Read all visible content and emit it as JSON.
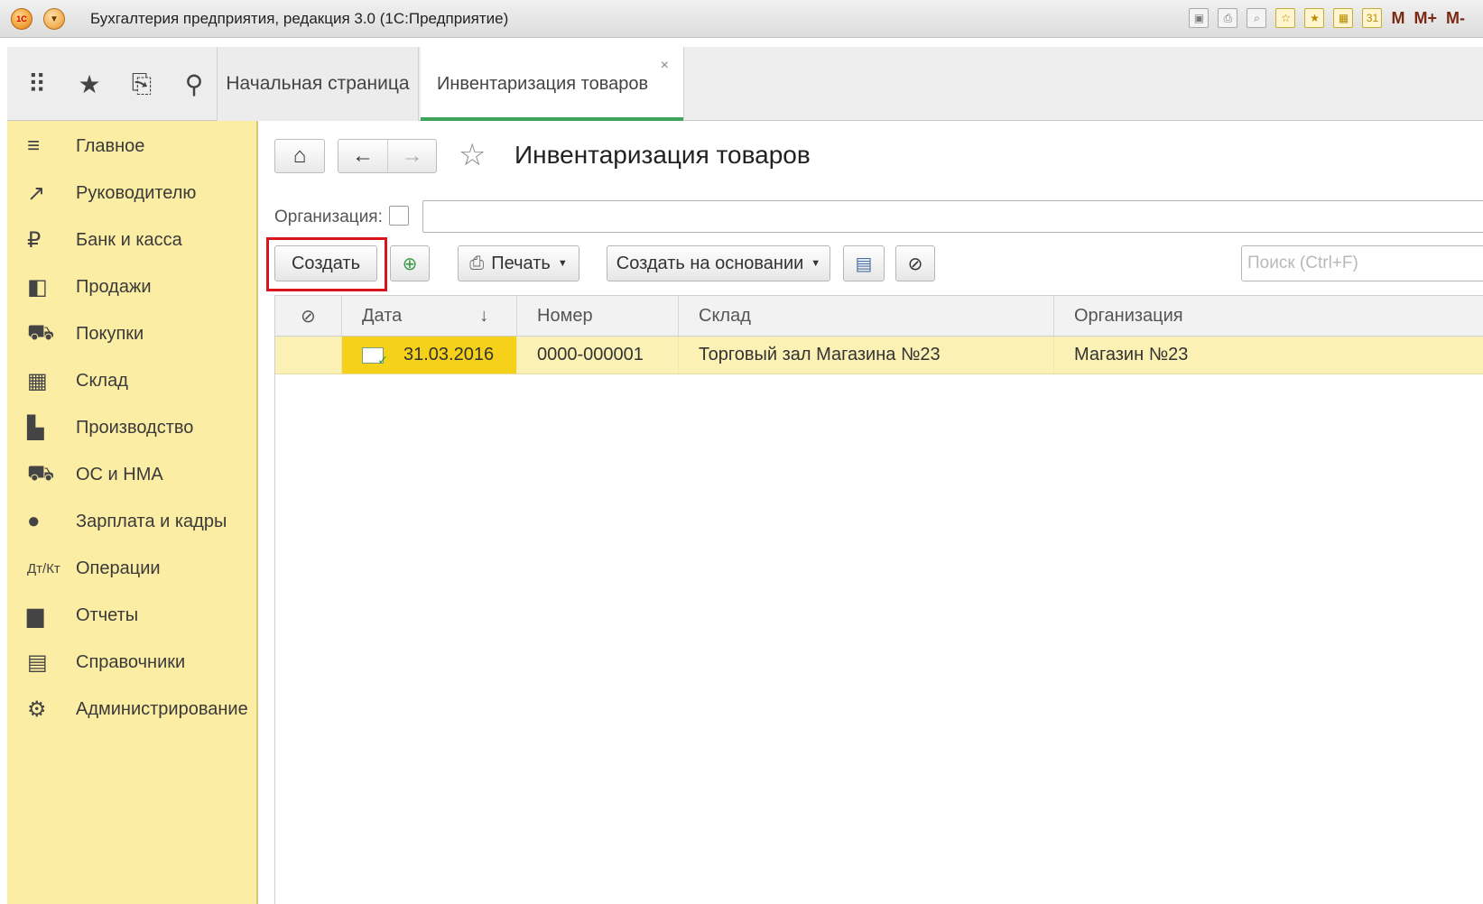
{
  "window": {
    "title": "Бухгалтерия предприятия, редакция 3.0  (1С:Предприятие)",
    "logo_text": "1С",
    "tools": [
      "save-icon",
      "print-icon",
      "preview-icon",
      "favorites-add-icon",
      "favorites-icon",
      "calculator-icon",
      "calendar-icon"
    ],
    "memory_buttons": [
      "M",
      "M+",
      "M-"
    ]
  },
  "tabs": {
    "home": "Начальная страница",
    "active": "Инвентаризация товаров",
    "close": "×"
  },
  "sidebar": {
    "items": [
      {
        "label": "Главное",
        "icon": "menu-lines-icon"
      },
      {
        "label": "Руководителю",
        "icon": "trend-chart-icon"
      },
      {
        "label": "Банк и касса",
        "icon": "ruble-coin-icon"
      },
      {
        "label": "Продажи",
        "icon": "shopping-bag-icon"
      },
      {
        "label": "Покупки",
        "icon": "cart-icon"
      },
      {
        "label": "Склад",
        "icon": "warehouse-grid-icon"
      },
      {
        "label": "Производство",
        "icon": "factory-icon"
      },
      {
        "label": "ОС и НМА",
        "icon": "truck-icon"
      },
      {
        "label": "Зарплата и кадры",
        "icon": "person-icon"
      },
      {
        "label": "Операции",
        "icon": "debit-credit-icon"
      },
      {
        "label": "Отчеты",
        "icon": "bar-chart-icon"
      },
      {
        "label": "Справочники",
        "icon": "books-icon"
      },
      {
        "label": "Администрирование",
        "icon": "gear-icon"
      }
    ]
  },
  "page": {
    "title": "Инвентаризация товаров",
    "org_label": "Организация:",
    "org_value": ""
  },
  "toolbar": {
    "create": "Создать",
    "print": "Печать",
    "create_based_on": "Создать на основании",
    "search_placeholder": "Поиск (Ctrl+F)"
  },
  "table": {
    "columns": [
      "",
      "Дата",
      "Номер",
      "Склад",
      "Организация"
    ],
    "sort_indicator": "↓",
    "rows": [
      {
        "date": "31.03.2016",
        "number": "0000-000001",
        "warehouse": "Торговый зал Магазина №23",
        "organization": "Магазин №23"
      }
    ]
  },
  "colors": {
    "sidebar_bg": "#fbeda3",
    "selected_row": "#fbf1b4",
    "selected_cell": "#f5d11a",
    "tab_underline": "#3fa45a",
    "highlight_frame": "#d9141a"
  }
}
